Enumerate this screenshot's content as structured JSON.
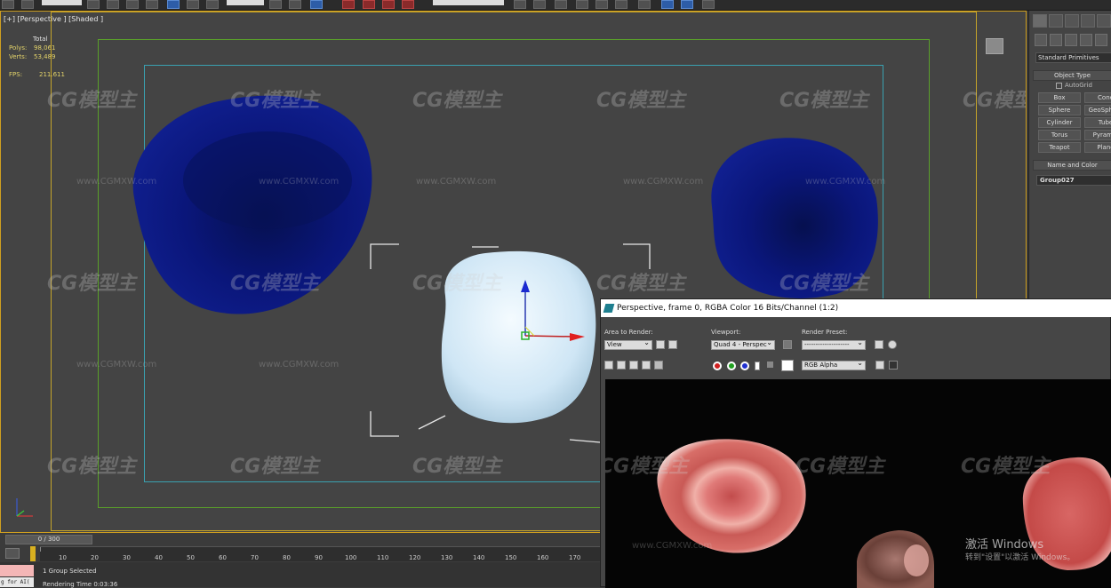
{
  "viewport": {
    "label": "[+] [Perspective ] [Shaded ]",
    "stats": {
      "header": "Total",
      "polys_label": "Polys:",
      "polys_value": "98,061",
      "verts_label": "Verts:",
      "verts_value": "53,489",
      "fps_label": "FPS:",
      "fps_value": "211.611"
    }
  },
  "command_panel": {
    "category": "Standard Primitives",
    "object_type_header": "Object Type",
    "autogrid_label": "AutoGrid",
    "buttons": [
      "Box",
      "Cone",
      "Sphere",
      "GeoSphere",
      "Cylinder",
      "Tube",
      "Torus",
      "Pyramid",
      "Teapot",
      "Plane"
    ],
    "name_color_header": "Name and Color",
    "object_name": "Group027"
  },
  "timeline": {
    "slider_label": "0 / 300",
    "ruler_numbers": [
      "10",
      "20",
      "30",
      "40",
      "50",
      "60",
      "70",
      "80",
      "90",
      "100",
      "110",
      "120",
      "130",
      "140",
      "150",
      "160",
      "170"
    ],
    "status_selected": "1 Group Selected",
    "status_render": "Rendering Time  0:03:36",
    "maxscript_text": "g for AI("
  },
  "render_window": {
    "title": "Perspective, frame 0, RGBA Color 16 Bits/Channel (1:2)",
    "area_label": "Area to Render:",
    "area_value": "View",
    "viewport_label": "Viewport:",
    "viewport_value": "Quad 4 - Perspec",
    "preset_label": "Render Preset:",
    "preset_value": "--------------------",
    "channel_value": "RGB Alpha"
  },
  "windows_activation": {
    "title": "激活 Windows",
    "subtitle": "转到\"设置\"以激活 Windows。"
  },
  "watermark": {
    "logo_text": "CG模型主",
    "url_text": "www.CGMXW.com"
  },
  "colors": {
    "viewport_bg": "#444444",
    "active_border": "#d0a020",
    "safe_frame_outer": "#5aa02a",
    "safe_frame_inner": "#3aa0b0",
    "blood_cell_blue": "#0a157a",
    "white_cell": "#d8ecf7"
  }
}
